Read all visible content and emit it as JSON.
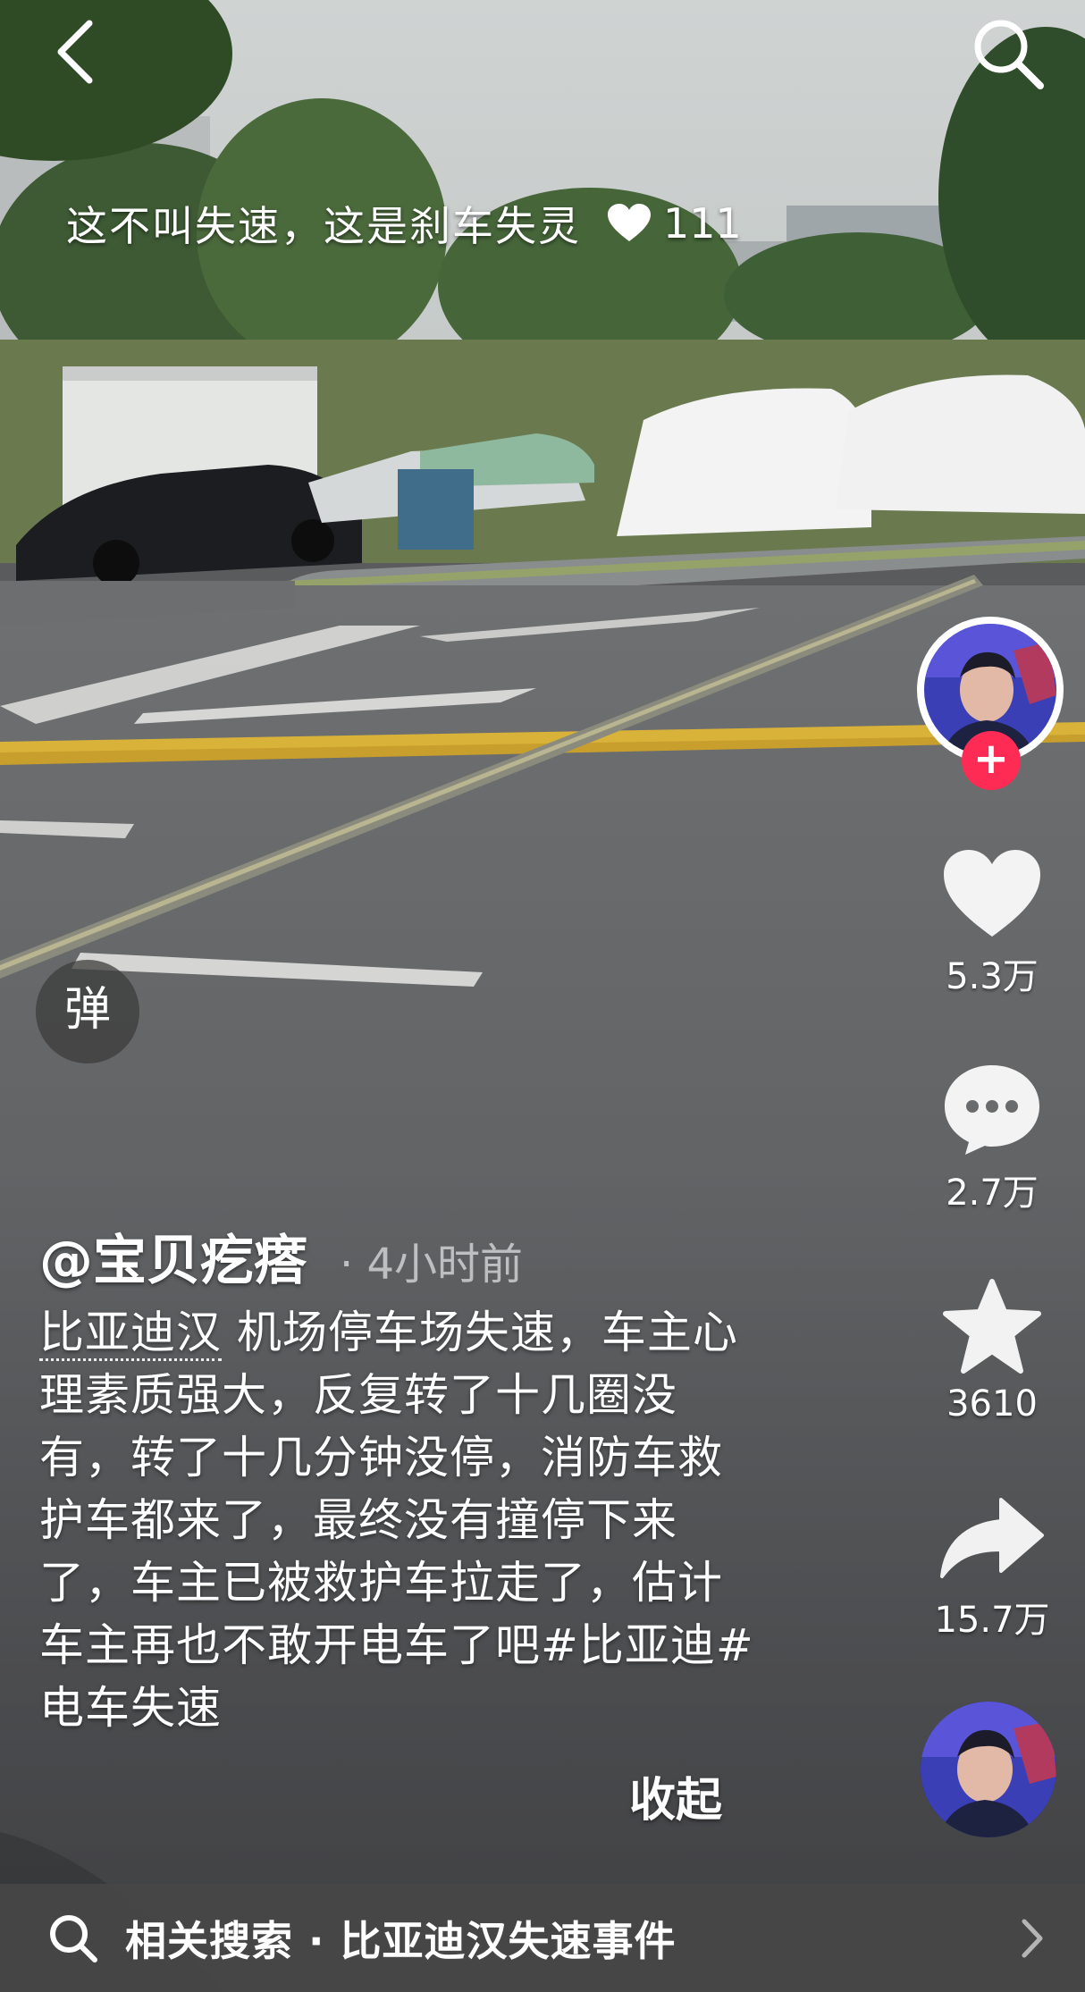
{
  "top_bar": {
    "back_icon": "chevron-left-icon",
    "search_icon": "search-icon"
  },
  "overlay_quote": {
    "text": "这不叫失速，这是刹车失灵",
    "like_icon": "heart-icon",
    "like_count": "111"
  },
  "sidebar": {
    "follow_label": "+",
    "like_count": "5.3万",
    "comment_count": "2.7万",
    "favorite_count": "3610",
    "share_count": "15.7万"
  },
  "danmaku": {
    "label": "弹"
  },
  "caption": {
    "author": "@宝贝疙瘩",
    "time": "· 4小时前",
    "tag": "比亚迪汉",
    "text": " 机场停车场失速，车主心理素质强大，反复转了十几圈没有，转了十几分钟没停，消防车救护车都来了，最终没有撞停下来了，车主已被救护车拉走了，估计车主再也不敢开电车了吧#比亚迪#电车失速",
    "collapse_label": "收起"
  },
  "related_search": {
    "label": "相关搜索 · 比亚迪汉失速事件"
  },
  "colors": {
    "follow": "#fe2c55",
    "road": "#5a5b5d",
    "lane_yellow": "#d9b23a"
  }
}
